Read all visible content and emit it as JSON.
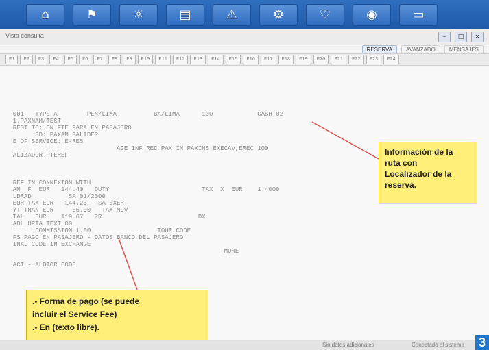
{
  "toolbar": {
    "buttons": [
      {
        "icon": "home-icon",
        "glyph": "⌂"
      },
      {
        "icon": "flag-icon",
        "glyph": "⚑"
      },
      {
        "icon": "sun-icon",
        "glyph": "☼"
      },
      {
        "icon": "chart-icon",
        "glyph": "▤"
      },
      {
        "icon": "warning-icon",
        "glyph": "⚠"
      },
      {
        "icon": "gear-icon",
        "glyph": "⚙"
      },
      {
        "icon": "heart-icon",
        "glyph": "♡"
      },
      {
        "icon": "globe-icon",
        "glyph": "◉"
      },
      {
        "icon": "document-icon",
        "glyph": "▭"
      }
    ],
    "colors": {
      "bar": "#2f6fbe",
      "button": "#5b92d8"
    }
  },
  "window": {
    "title": "Vista consulta"
  },
  "tabs": [
    {
      "label": "RESERVA"
    },
    {
      "label": "AVANZADO"
    },
    {
      "label": "MENSAJES"
    }
  ],
  "fkeys": [
    "F1",
    "F2",
    "F3",
    "F4",
    "F5",
    "F6",
    "F7",
    "F8",
    "F9",
    "F10",
    "F11",
    "F12",
    "F13",
    "F14",
    "F15",
    "F16",
    "F17",
    "F18",
    "F19",
    "F20",
    "F21",
    "F22",
    "F23",
    "F24"
  ],
  "terminal": {
    "lines": [
      "",
      "",
      "",
      "",
      "",
      "  001   TYPE A        PEN/LIMA          BA/LIMA      100            CASH 02",
      "  1.PAXNAM/TEST",
      "  REST TO: ON FTE PARA EN PASAJERO",
      "        SD: PAXAM BALIDER",
      "  E OF SERVICE: E-RES",
      "                              AGE INF REC PAX IN PAXINS EXECAV,EREC 100",
      "  ALIZADOR PTEREF",
      "",
      "",
      "",
      "  REF IN CONNEXION WITH",
      "  AM  F  EUR   144.40   DUTY                         TAX  X  EUR    1.4000",
      "  LDRAD          SA 01/2000",
      "  EUR TAX EUR   144.23   SA EXER",
      "  YT TRAN EUR     35.00   TAX MOV",
      "  TAL   EUR    119.67   RR                          DX",
      "  ADL UPTA TEXT 00",
      "        COMMISSION 1.00                  TOUR CODE",
      "  FS PAGO EN PASAJERO - DATOS BANCO DEL PASAJERO",
      "  INAL CODE IN EXCHANGE",
      "                                                           MORE",
      "",
      "  ACI - ALBIOR CODE"
    ]
  },
  "callouts": {
    "right": {
      "lines": [
        "Información de la",
        "ruta con",
        "Localizador de la",
        "reserva."
      ]
    },
    "bottom": {
      "line1": ".- Forma de pago (se puede",
      "line2": "incluir el Service Fee)",
      "line3": ".- En (texto libre)."
    },
    "colors": {
      "background": "#ffef78",
      "border": "#c9b400",
      "connector": "#d9534f"
    }
  },
  "status": {
    "left": "Sin datos adicionales",
    "right": "Conectado al sistema"
  },
  "page_number": "3"
}
